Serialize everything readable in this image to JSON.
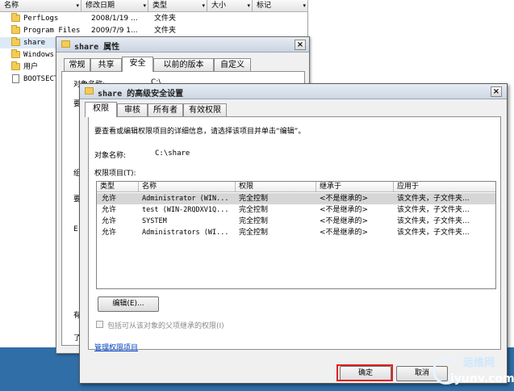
{
  "explorer": {
    "columns": [
      "名称",
      "修改日期",
      "类型",
      "大小",
      "标记"
    ],
    "rows": [
      {
        "name": "PerfLogs",
        "date": "2008/1/19 ...",
        "type": "文件夹",
        "icon": "folder-icon"
      },
      {
        "name": "Program Files",
        "date": "2009/7/9 1...",
        "type": "文件夹",
        "icon": "folder-icon"
      },
      {
        "name": "share",
        "date": "",
        "type": "",
        "icon": "folder-icon"
      },
      {
        "name": "Windows",
        "date": "",
        "type": "",
        "icon": "folder-icon"
      },
      {
        "name": "用户",
        "date": "",
        "type": "",
        "icon": "folder-icon"
      },
      {
        "name": "BOOTSECT.",
        "date": "",
        "type": "",
        "icon": "file-icon"
      }
    ]
  },
  "properties": {
    "title": "share 属性",
    "close": "×",
    "tabs": [
      "常规",
      "共享",
      "安全",
      "以前的版本",
      "自定义"
    ],
    "partial_obj_label": "对象名称:",
    "partial_obj_value": "C:\\",
    "partial_text_1": "要",
    "partial_text_2": "组",
    "partial_text_3": "要",
    "partial_text_4": "E",
    "partial_text_5": "有",
    "partial_text_6": "了"
  },
  "advanced": {
    "title": "share 的高级安全设置",
    "close": "×",
    "tabs": [
      "权限",
      "审核",
      "所有者",
      "有效权限"
    ],
    "instruction": "要查看或编辑权限项目的详细信息，请选择该项目并单击“编辑”。",
    "object_name_label": "对象名称:",
    "object_name_value": "C:\\share",
    "entries_label": "权限项目(T):",
    "grid_headers": [
      "类型",
      "名称",
      "权限",
      "继承于",
      "应用于"
    ],
    "grid_rows": [
      {
        "type": "允许",
        "name": "Administrator (WIN...",
        "perm": "完全控制",
        "inherit": "<不是继承的>",
        "apply": "该文件夹，子文件夹..."
      },
      {
        "type": "允许",
        "name": "test (WIN-2RQDXV1Q...",
        "perm": "完全控制",
        "inherit": "<不是继承的>",
        "apply": "该文件夹，子文件夹..."
      },
      {
        "type": "允许",
        "name": "SYSTEM",
        "perm": "完全控制",
        "inherit": "<不是继承的>",
        "apply": "该文件夹，子文件夹..."
      },
      {
        "type": "允许",
        "name": "Administrators (WI...",
        "perm": "完全控制",
        "inherit": "<不是继承的>",
        "apply": "该文件夹，子文件夹..."
      }
    ],
    "edit_button": "编辑(E)...",
    "inherit_checkbox": "包括可从该对象的父项继承的权限(I)",
    "manage_link": "管理权限项目",
    "ok_button": "确定",
    "cancel_button": "取消"
  },
  "watermark": {
    "line1": "运维网",
    "line2": "iyunv.com"
  }
}
